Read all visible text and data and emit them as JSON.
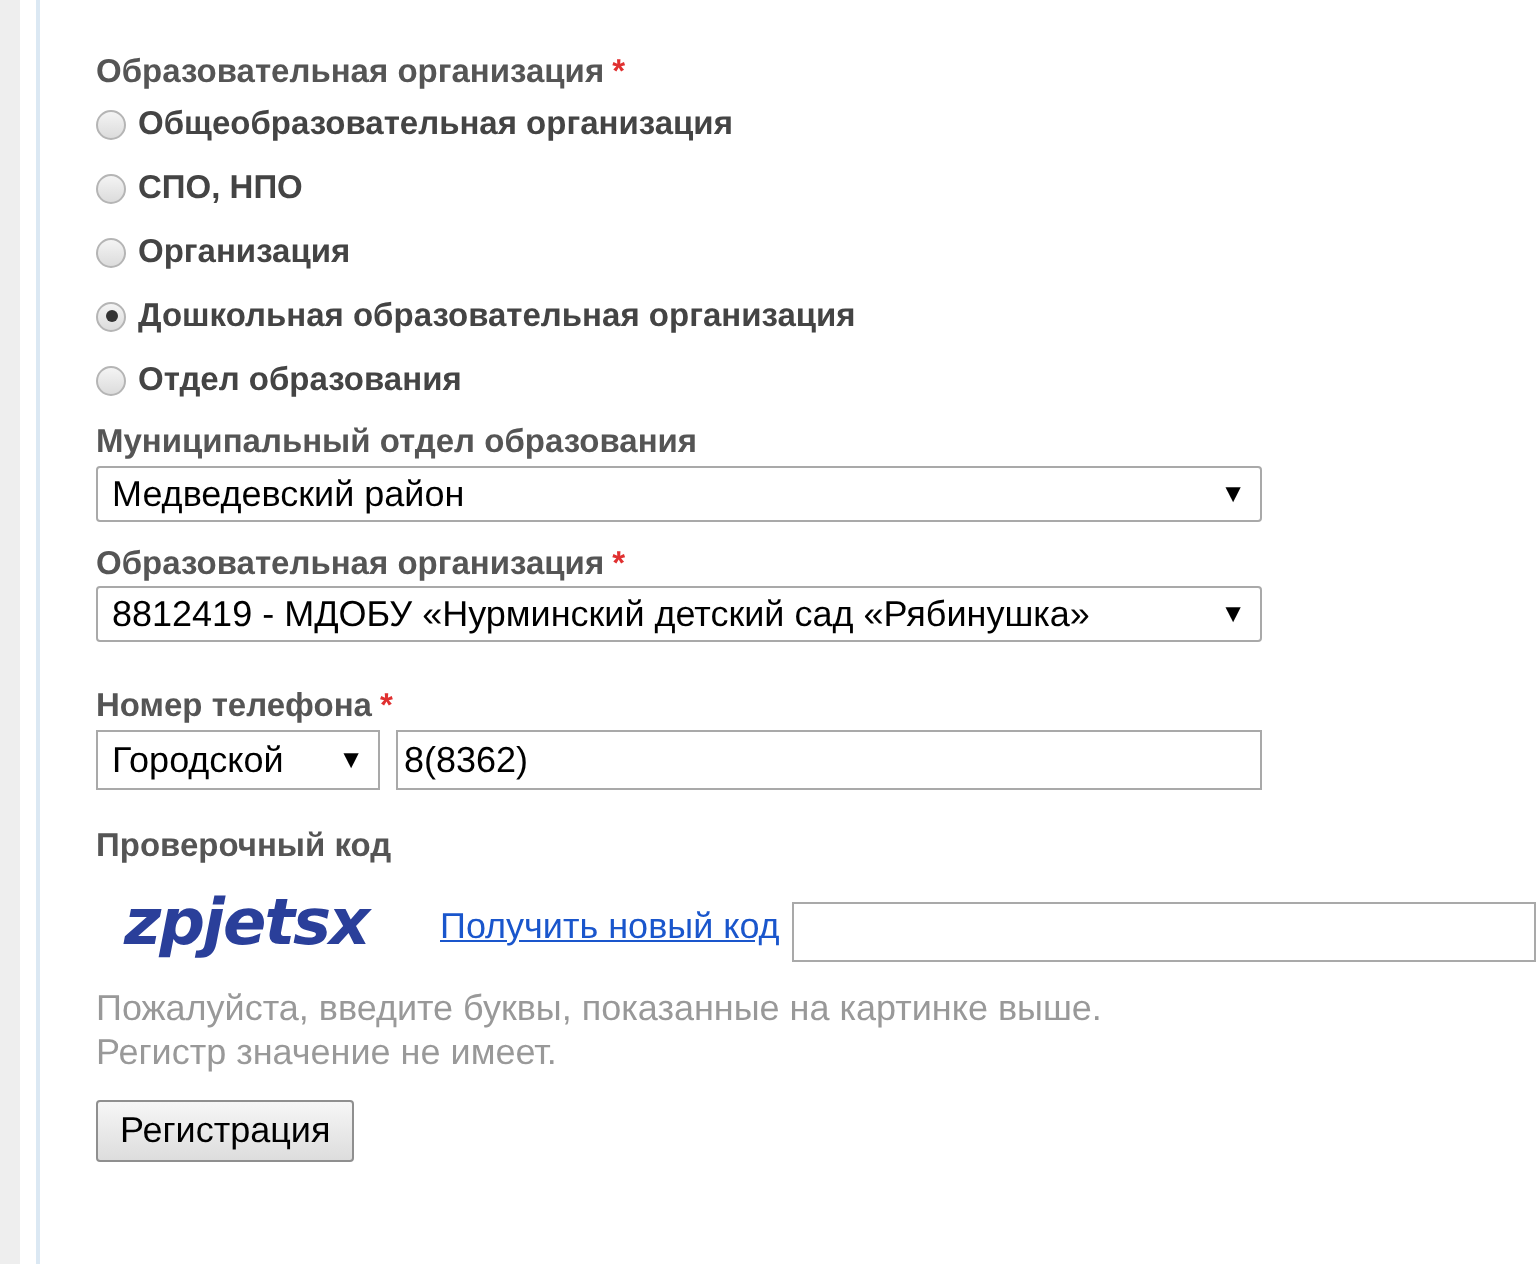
{
  "org_type": {
    "label": "Образовательная организация",
    "required_mark": "*",
    "options": [
      {
        "label": "Общеобразовательная организация",
        "selected": false
      },
      {
        "label": "СПО, НПО",
        "selected": false
      },
      {
        "label": "Организация",
        "selected": false
      },
      {
        "label": "Дошкольная образовательная организация",
        "selected": true
      },
      {
        "label": "Отдел образования",
        "selected": false
      }
    ]
  },
  "municipal": {
    "label": "Муниципальный отдел образования",
    "value": "Медведевский район",
    "arrow": "▼"
  },
  "organization": {
    "label": "Образовательная организация",
    "required_mark": "*",
    "value": "8812419 - МДОБУ «Нурминский детский сад «Рябинушка»",
    "arrow": "▼"
  },
  "phone": {
    "label": "Номер телефона",
    "required_mark": "*",
    "type_value": "Городской",
    "arrow": "▼",
    "value": "8(8362)"
  },
  "captcha": {
    "label": "Проверочный код",
    "code": "zpjetsx",
    "refresh_link": "Получить новый код",
    "help": [
      "Пожалуйста, введите буквы, показанные на картинке выше.",
      "Регистр значение не имеет."
    ]
  },
  "submit": "Регистрация"
}
